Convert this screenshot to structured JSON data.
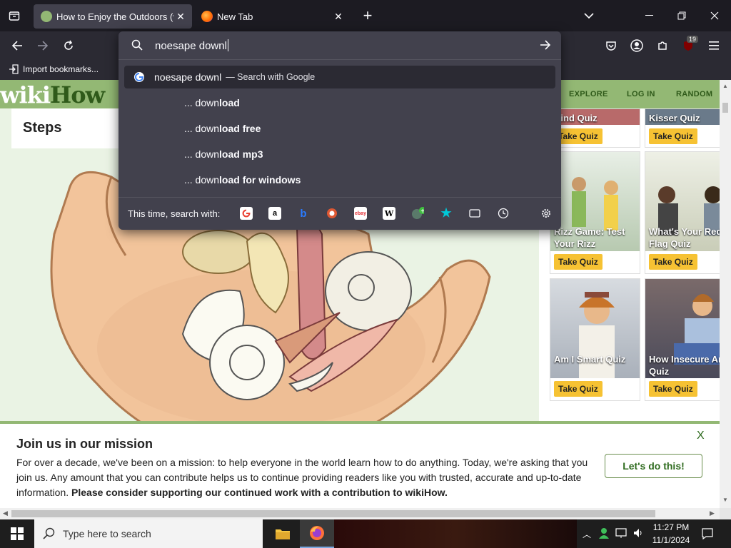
{
  "tabs": [
    {
      "title": "How to Enjoy the Outdoors (wit",
      "active": true
    },
    {
      "title": "New Tab",
      "active": false
    }
  ],
  "toolbar": {
    "new_tab_symbol": "+",
    "bookmark_import": "Import bookmarks...",
    "extension_badge": "19"
  },
  "urlbar": {
    "typed": "noesape downl",
    "suggestions": [
      {
        "typed": "noesape downl",
        "hint": "— Search with Google"
      },
      {
        "prefix": "... down",
        "bold": "load"
      },
      {
        "prefix": "... down",
        "bold": "load free"
      },
      {
        "prefix": "... down",
        "bold": "load mp3"
      },
      {
        "prefix": "... down",
        "bold": "load for windows"
      }
    ],
    "engines_label": "This time, search with:",
    "engines": [
      "google-icon",
      "amazon-icon",
      "bing-icon",
      "duckduckgo-icon",
      "ebay-icon",
      "wikipedia-icon",
      "add-engine-icon",
      "bookmarks-star-icon",
      "tabs-icon",
      "history-icon",
      "settings-gear-icon"
    ]
  },
  "wikihow": {
    "logo_wiki": "wiki",
    "logo_how": "How",
    "nav": [
      "EXPLORE",
      "LOG IN",
      "RANDOM"
    ],
    "steps_label": "Steps",
    "quizzes": [
      {
        "title": "Kind Quiz",
        "button": "Take Quiz"
      },
      {
        "title": "Kisser Quiz",
        "button": "Take Quiz"
      },
      {
        "title": "Rizz Game: Test Your Rizz",
        "button": "Take Quiz"
      },
      {
        "title": "What's Your Red Flag Quiz",
        "button": "Take Quiz"
      },
      {
        "title": "Am I Smart Quiz",
        "button": "Take Quiz"
      },
      {
        "title": "How Insecure Am I Quiz",
        "button": "Take Quiz"
      }
    ],
    "mission": {
      "title": "Join us in our mission",
      "body": "For over a decade, we've been on a mission: to help everyone in the world learn how to do anything. Today, we're asking that you join us. Any amount that you can contribute helps us to continue providing readers like you with trusted, accurate and up-to-date information.",
      "body_bold": "Please consider supporting our continued work with a contribution to wikiHow.",
      "cta": "Let's do this!",
      "close": "X"
    }
  },
  "taskbar": {
    "search_placeholder": "Type here to search",
    "time": "11:27 PM",
    "date": "11/1/2024"
  },
  "colors": {
    "wikihow_green": "#93b874",
    "firefox_dark": "#2b2a33",
    "quiz_yellow": "#f6c233"
  }
}
